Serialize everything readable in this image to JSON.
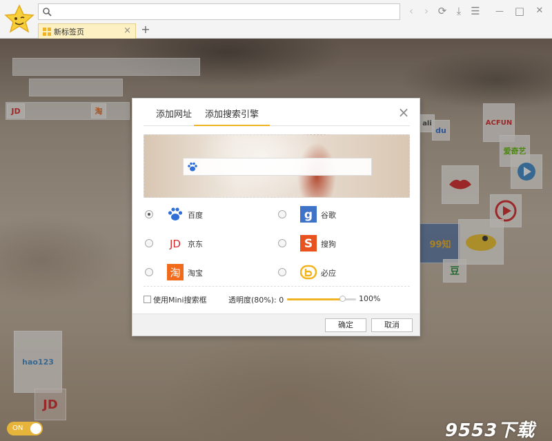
{
  "browser": {
    "address_placeholder": "",
    "tab_label": "新标签页",
    "new_tab_symbol": "+",
    "tab_close_symbol": "×",
    "nav": {
      "back": "‹",
      "forward": "›",
      "refresh": "⟳",
      "download": "⤓",
      "menu": "☰",
      "minimize": "—",
      "maximize": "□",
      "close": "✕"
    }
  },
  "background": {
    "tiles": [
      "JD",
      "淘",
      "ali",
      "du",
      "ACFUN",
      "爱奇艺",
      "hao123",
      "99知",
      "豆",
      "JD"
    ],
    "toggle_label": "ON",
    "watermark": "9553下载"
  },
  "dialog": {
    "tabs": [
      "添加网址",
      "添加搜索引擎"
    ],
    "active_tab": 1,
    "close_symbol": "×",
    "engines": [
      {
        "name": "百度",
        "icon": "baidu-icon",
        "checked": true
      },
      {
        "name": "谷歌",
        "icon": "google-icon",
        "checked": false
      },
      {
        "name": "京东",
        "icon": "jd-icon",
        "checked": false
      },
      {
        "name": "搜狗",
        "icon": "sogou-icon",
        "checked": false
      },
      {
        "name": "淘宝",
        "icon": "taobao-icon",
        "checked": false
      },
      {
        "name": "必应",
        "icon": "bing-icon",
        "checked": false
      }
    ],
    "mini_searchbox_label": "使用Mini搜索框",
    "mini_searchbox_checked": false,
    "opacity_label": "透明度(80%): 0",
    "opacity_value": 0.8,
    "opacity_max": "100%",
    "ok_label": "确定",
    "cancel_label": "取消"
  },
  "colors": {
    "accent": "#f0b323",
    "baidu": "#2f6fd6",
    "google": "#3f73c8",
    "jd": "#d9282a",
    "sogou": "#e8521e",
    "taobao": "#f26b1d",
    "bing": "#f2b41a"
  }
}
